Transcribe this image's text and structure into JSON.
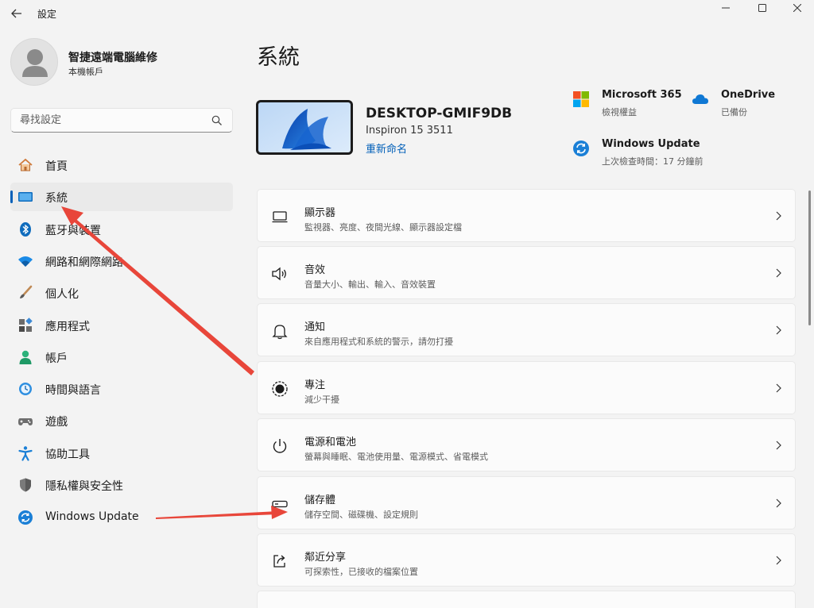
{
  "window": {
    "title": "設定",
    "back_icon": "arrow-left-icon",
    "controls": [
      "minimize-icon",
      "maximize-icon",
      "close-icon"
    ]
  },
  "profile": {
    "name": "智捷遠端電腦維修",
    "subtitle": "本機帳戶"
  },
  "search": {
    "placeholder": "尋找設定",
    "icon": "search-icon"
  },
  "sidebar": {
    "items": [
      {
        "label": "首頁",
        "icon": "home-icon"
      },
      {
        "label": "系統",
        "icon": "system-icon",
        "active": true
      },
      {
        "label": "藍牙與裝置",
        "icon": "bluetooth-icon"
      },
      {
        "label": "網路和網際網路",
        "icon": "wifi-icon"
      },
      {
        "label": "個人化",
        "icon": "brush-icon"
      },
      {
        "label": "應用程式",
        "icon": "apps-icon"
      },
      {
        "label": "帳戶",
        "icon": "account-icon"
      },
      {
        "label": "時間與語言",
        "icon": "time-language-icon"
      },
      {
        "label": "遊戲",
        "icon": "gamepad-icon"
      },
      {
        "label": "協助工具",
        "icon": "accessibility-icon"
      },
      {
        "label": "隱私權與安全性",
        "icon": "shield-icon"
      },
      {
        "label": "Windows Update",
        "icon": "windows-update-icon"
      }
    ]
  },
  "main": {
    "title": "系統",
    "device": {
      "name": "DESKTOP-GMIF9DB",
      "model": "Inspiron 15 3511",
      "rename_label": "重新命名"
    },
    "quick_links": [
      {
        "title": "Microsoft 365",
        "subtitle": "檢視權益",
        "icon": "microsoft-logo-icon"
      },
      {
        "title": "OneDrive",
        "subtitle": "已備份",
        "icon": "cloud-icon"
      },
      {
        "title": "Windows Update",
        "subtitle": "上次檢查時間：17 分鐘前",
        "icon": "windows-update-icon"
      }
    ],
    "cards": [
      {
        "title": "顯示器",
        "subtitle": "監視器、亮度、夜間光線、顯示器設定檔",
        "icon": "display-icon"
      },
      {
        "title": "音效",
        "subtitle": "音量大小、輸出、輸入、音效裝置",
        "icon": "speaker-icon"
      },
      {
        "title": "通知",
        "subtitle": "來自應用程式和系統的警示，請勿打擾",
        "icon": "bell-icon"
      },
      {
        "title": "專注",
        "subtitle": "減少干擾",
        "icon": "focus-icon"
      },
      {
        "title": "電源和電池",
        "subtitle": "螢幕與睡眠、電池使用量、電源模式、省電模式",
        "icon": "power-icon"
      },
      {
        "title": "儲存體",
        "subtitle": "儲存空間、磁碟機、設定規則",
        "icon": "storage-icon"
      },
      {
        "title": "鄰近分享",
        "subtitle": "可探索性，已接收的檔案位置",
        "icon": "share-icon"
      }
    ]
  },
  "colors": {
    "accent": "#005fb8",
    "annotation_arrow": "#e8463a",
    "background": "#f3f3f3",
    "card": "#fbfbfb"
  }
}
